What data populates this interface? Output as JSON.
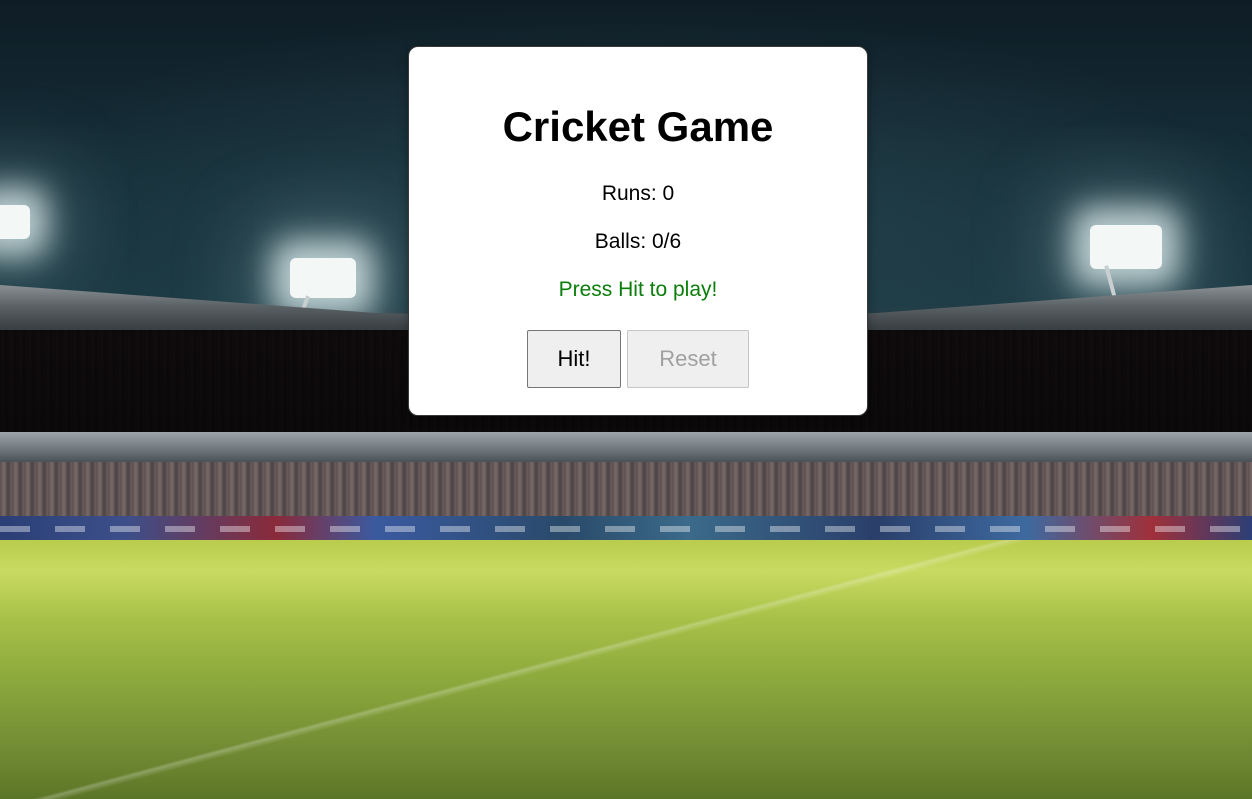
{
  "game": {
    "title": "Cricket Game",
    "runs_text": "Runs: 0",
    "balls_text": "Balls: 0/6",
    "message": "Press Hit to play!",
    "message_color": "#0a7d0a"
  },
  "controls": {
    "hit_label": "Hit!",
    "reset_label": "Reset",
    "reset_disabled": true
  },
  "background": {
    "scene": "cricket-stadium-night"
  }
}
